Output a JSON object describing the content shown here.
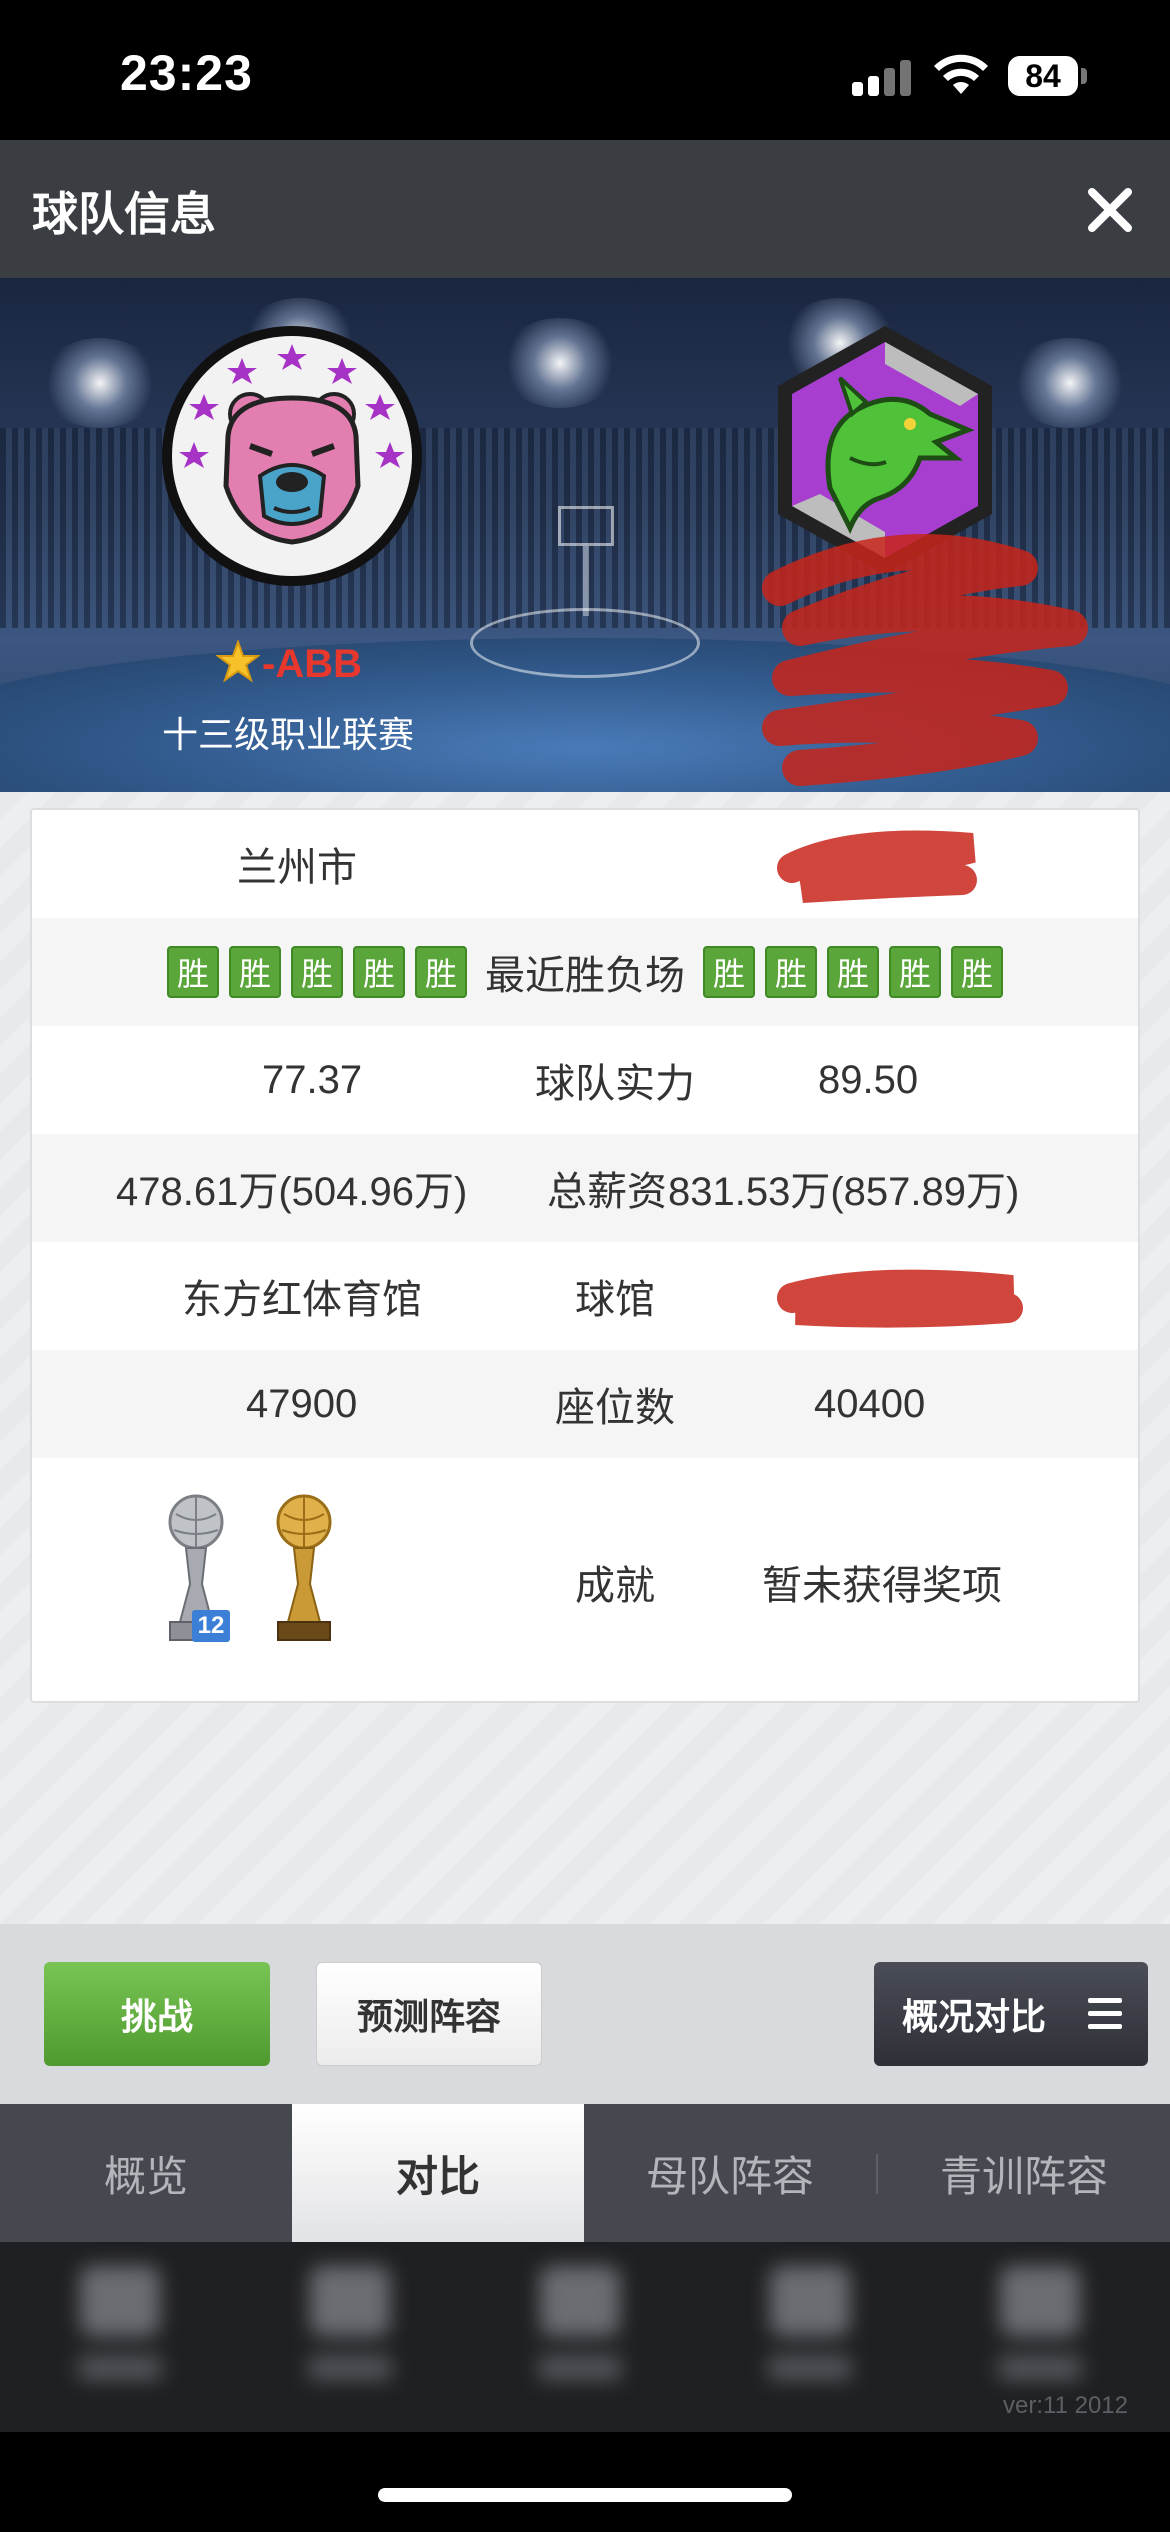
{
  "status_bar": {
    "time": "23:23",
    "battery": "84"
  },
  "header": {
    "title": "球队信息",
    "close_icon": "close-icon"
  },
  "banner": {
    "home_team": {
      "name": "-ABB",
      "league": "十三级职业联赛",
      "logo": "bear-logo"
    },
    "away_team": {
      "logo": "dragon-logo"
    }
  },
  "info": {
    "city": {
      "home": "兰州市",
      "away": ""
    },
    "recent": {
      "label": "最近胜负场",
      "home": [
        "胜",
        "胜",
        "胜",
        "胜",
        "胜"
      ],
      "away": [
        "胜",
        "胜",
        "胜",
        "胜",
        "胜"
      ]
    },
    "strength": {
      "label": "球队实力",
      "home": "77.37",
      "away": "89.50"
    },
    "salary": {
      "label": "总薪资",
      "home": "478.61万(504.96万)",
      "away": "831.53万(857.89万)"
    },
    "arena": {
      "label": "球馆",
      "home": "东方红体育馆",
      "away": ""
    },
    "seats": {
      "label": "座位数",
      "home": "47900",
      "away": "40400"
    },
    "achievement": {
      "label": "成就",
      "home_badge": "12",
      "away": "暂未获得奖项"
    }
  },
  "actions": {
    "challenge": "挑战",
    "predict": "预测阵容",
    "compare": "概况对比"
  },
  "tabs": [
    {
      "label": "概览",
      "active": false
    },
    {
      "label": "对比",
      "active": true
    },
    {
      "label": "母队阵容",
      "active": false
    },
    {
      "label": "青训阵容",
      "active": false
    }
  ],
  "footer": {
    "version": "ver:11  2012"
  },
  "colors": {
    "win_badge": "#5aa63a",
    "team_name": "#e8372c",
    "title_bar": "#3a3d42",
    "tab_bar": "#45484f"
  }
}
